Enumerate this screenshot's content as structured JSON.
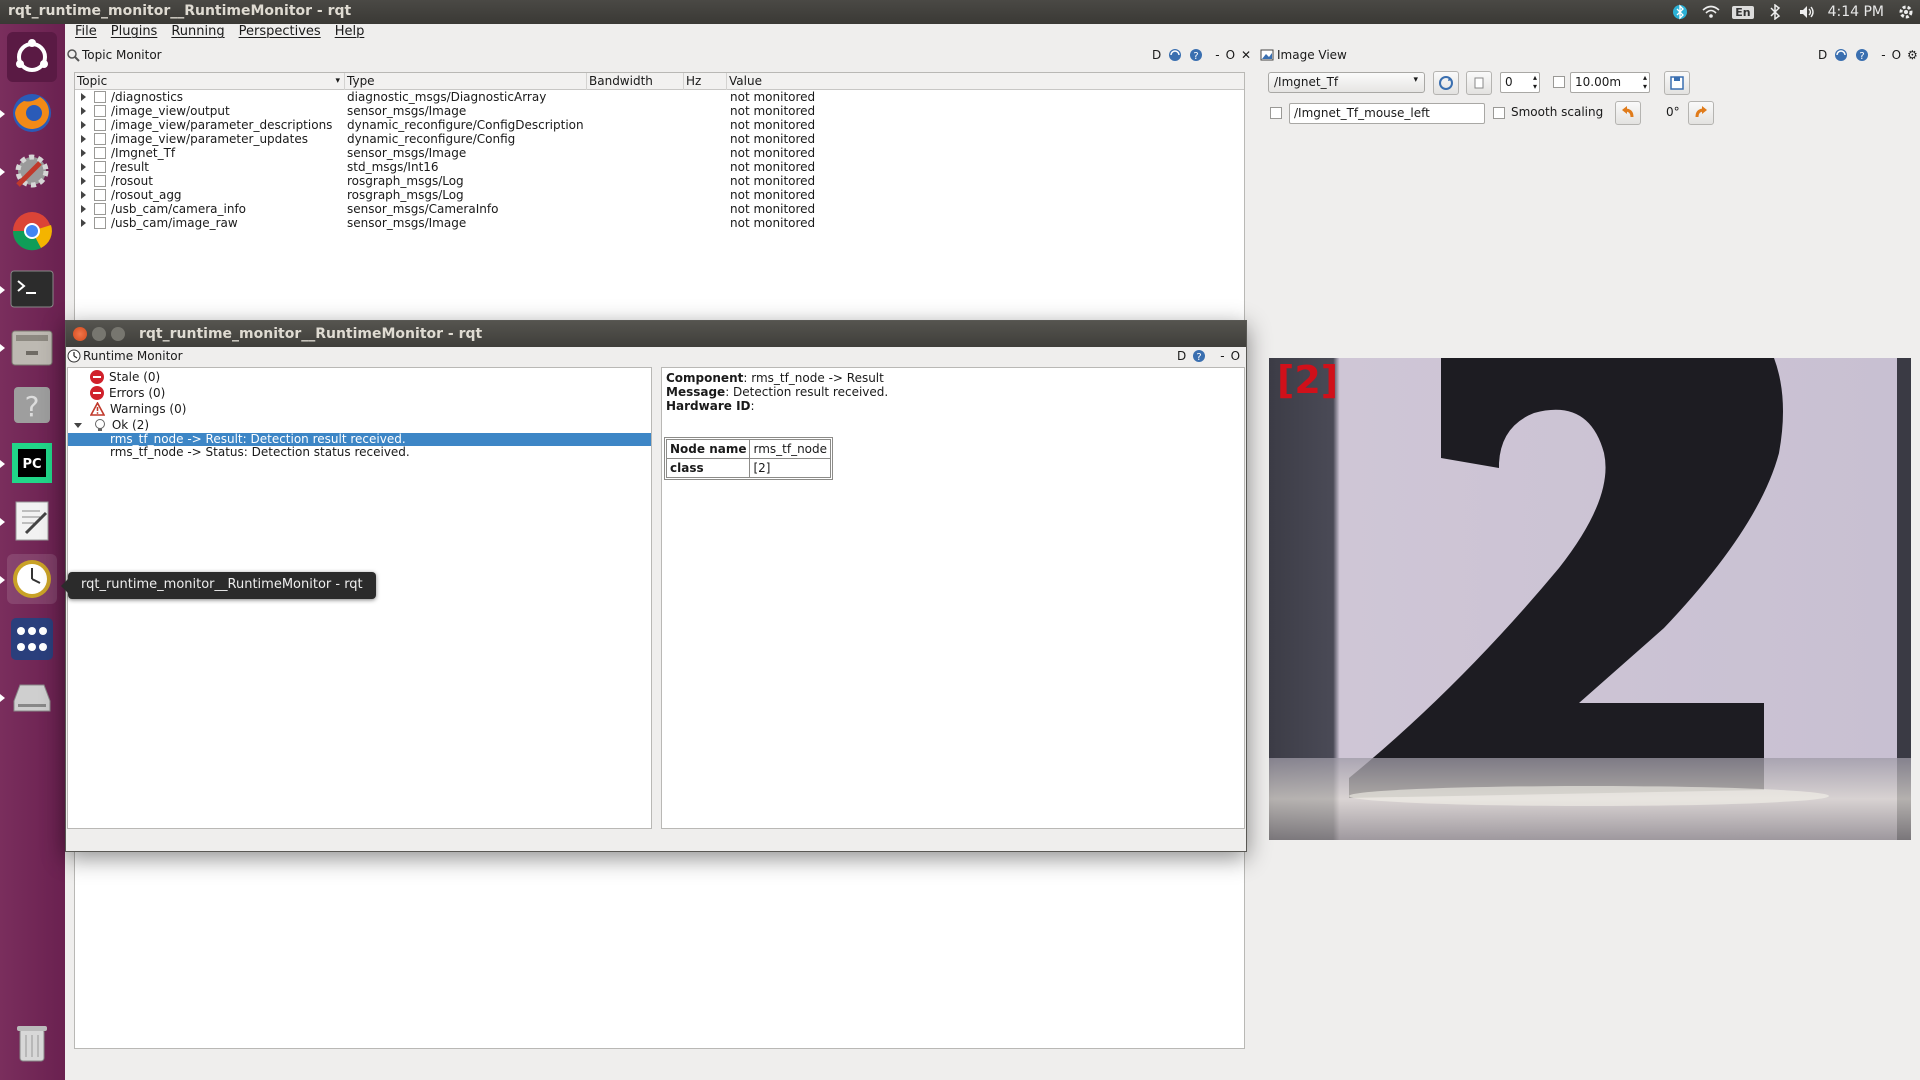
{
  "window_title": "rqt_runtime_monitor__RuntimeMonitor - rqt",
  "tray": {
    "keyboard": "En",
    "time": "4:14 PM"
  },
  "menubar": [
    "File",
    "Plugins",
    "Running",
    "Perspectives",
    "Help"
  ],
  "topic_monitor": {
    "title": "Topic Monitor",
    "dock_controls": [
      "D",
      "O"
    ],
    "columns": [
      "Topic",
      "Type",
      "Bandwidth",
      "Hz",
      "Value"
    ],
    "rows": [
      {
        "topic": "/diagnostics",
        "type": "diagnostic_msgs/DiagnosticArray",
        "value": "not monitored"
      },
      {
        "topic": "/image_view/output",
        "type": "sensor_msgs/Image",
        "value": "not monitored"
      },
      {
        "topic": "/image_view/parameter_descriptions",
        "type": "dynamic_reconfigure/ConfigDescription",
        "value": "not monitored"
      },
      {
        "topic": "/image_view/parameter_updates",
        "type": "dynamic_reconfigure/Config",
        "value": "not monitored"
      },
      {
        "topic": "/Imgnet_Tf",
        "type": "sensor_msgs/Image",
        "value": "not monitored"
      },
      {
        "topic": "/result",
        "type": "std_msgs/Int16",
        "value": "not monitored"
      },
      {
        "topic": "/rosout",
        "type": "rosgraph_msgs/Log",
        "value": "not monitored"
      },
      {
        "topic": "/rosout_agg",
        "type": "rosgraph_msgs/Log",
        "value": "not monitored"
      },
      {
        "topic": "/usb_cam/camera_info",
        "type": "sensor_msgs/CameraInfo",
        "value": "not monitored"
      },
      {
        "topic": "/usb_cam/image_raw",
        "type": "sensor_msgs/Image",
        "value": "not monitored"
      }
    ]
  },
  "runtime_window": {
    "title": "rqt_runtime_monitor__RuntimeMonitor - rqt",
    "panel_title": "Runtime Monitor",
    "dock_controls": [
      "D",
      "O"
    ],
    "tree": {
      "stale": "Stale (0)",
      "errors": "Errors (0)",
      "warnings": "Warnings (0)",
      "ok": "Ok (2)",
      "items": [
        "rms_tf_node -> Result: Detection result received.",
        "rms_tf_node -> Status: Detection status received."
      ]
    },
    "detail": {
      "component_label": "Component",
      "component_value": ": rms_tf_node -> Result",
      "message_label": "Message",
      "message_value": ": Detection result received.",
      "hwid_label": "Hardware ID",
      "hwid_value": ":",
      "table": [
        {
          "key": "Node name",
          "value": "rms_tf_node"
        },
        {
          "key": "class",
          "value": "[2]"
        }
      ]
    }
  },
  "image_view": {
    "title": "Image View",
    "dock_controls": [
      "D",
      "O"
    ],
    "topic": "/Imgnet_Tf",
    "spin_value": "0",
    "duration": "10.00m",
    "mouse_topic": "/Imgnet_Tf_mouse_left",
    "smooth_label": "Smooth scaling",
    "rotation": "0°",
    "overlay_label": "[2]",
    "digit": "2"
  },
  "tooltip": "rqt_runtime_monitor__RuntimeMonitor - rqt",
  "colors": {
    "selection": "#3d86c6",
    "launcher": "#6a2150",
    "error": "#d0212b",
    "overlay": "#d0101a"
  }
}
